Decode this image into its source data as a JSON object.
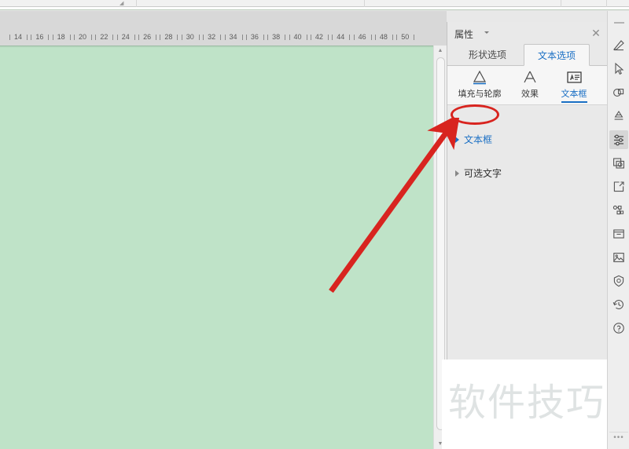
{
  "app": {
    "canvas_color": "#bfe3c8",
    "accent_color": "#1a6fc4",
    "annotation_color": "#d8241f"
  },
  "ruler": {
    "name": "horizontal-ruler",
    "unit_labels": [
      "14",
      "16",
      "18",
      "20",
      "22",
      "24",
      "26",
      "28",
      "30",
      "32",
      "34",
      "36",
      "38",
      "40",
      "42",
      "44",
      "46",
      "48",
      "50"
    ],
    "start_value": 13,
    "end_value": 50
  },
  "scrollbar": {
    "up_glyph": "▲",
    "down_glyph": "▼"
  },
  "panel": {
    "title": "属性",
    "close_label": "✕",
    "tabs": [
      {
        "label": "形状选项",
        "active": false
      },
      {
        "label": "文本选项",
        "active": true
      }
    ],
    "subtabs": [
      {
        "label": "填充与轮廓",
        "icon": "fill-and-outline-icon",
        "active": false
      },
      {
        "label": "效果",
        "icon": "effects-icon",
        "active": false
      },
      {
        "label": "文本框",
        "icon": "text-box-icon",
        "active": true
      }
    ],
    "sections": [
      {
        "label": "文本框",
        "highlighted": true
      },
      {
        "label": "可选文字",
        "highlighted": false
      }
    ]
  },
  "rail": {
    "items": [
      {
        "name": "pen-icon",
        "active": false
      },
      {
        "name": "cursor-select-icon",
        "active": false
      },
      {
        "name": "shapes-icon",
        "active": false
      },
      {
        "name": "smart-art-icon",
        "active": false
      },
      {
        "name": "properties-sliders-icon",
        "active": true
      },
      {
        "name": "screenshot-icon",
        "active": false
      },
      {
        "name": "export-icon",
        "active": false
      },
      {
        "name": "design-ideas-icon",
        "active": false
      },
      {
        "name": "inbox-icon",
        "active": false
      },
      {
        "name": "picture-icon",
        "active": false
      },
      {
        "name": "security-icon",
        "active": false
      },
      {
        "name": "history-icon",
        "active": false
      },
      {
        "name": "help-icon",
        "active": false
      }
    ],
    "overflow_label": "•••"
  },
  "watermark": {
    "text": "软件技巧"
  }
}
